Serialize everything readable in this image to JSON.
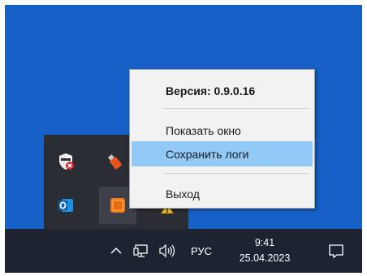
{
  "menu": {
    "version_label": "Версия: 0.9.0.16",
    "show_window_label": "Показать окно",
    "save_logs_label": "Сохранить логи",
    "exit_label": "Выход"
  },
  "tray_overflow": {
    "icons": [
      "defender-shield-icon",
      "usb-drive-icon",
      "outlook-icon",
      "app-orange-icon",
      "network-warning-icon"
    ]
  },
  "taskbar": {
    "chevron_icon": "chevron-up-icon",
    "network_icon": "network-icon",
    "volume_icon": "speaker-icon",
    "language": "РУС",
    "time": "9:41",
    "date": "25.04.2023",
    "notification_icon": "action-center-icon"
  },
  "colors": {
    "desktop": "#1660c8",
    "taskbar": "#1d2330",
    "menu_background": "#f2f2f2",
    "menu_highlight": "#91c9f7"
  }
}
